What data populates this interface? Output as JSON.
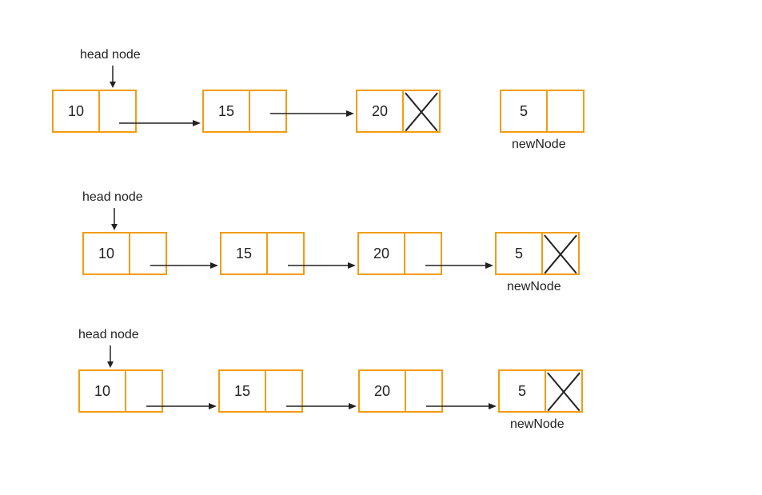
{
  "row1": {
    "headLabel": "head node",
    "nodes": [
      {
        "value": "10",
        "hasNext": true,
        "nullNext": false
      },
      {
        "value": "15",
        "hasNext": true,
        "nullNext": false
      },
      {
        "value": "20",
        "hasNext": false,
        "nullNext": true
      }
    ],
    "newNode": {
      "value": "5",
      "label": "newNode",
      "nullNext": false
    }
  },
  "row2": {
    "headLabel": "head node",
    "nodes": [
      {
        "value": "10",
        "hasNext": true,
        "nullNext": false
      },
      {
        "value": "15",
        "hasNext": true,
        "nullNext": false
      },
      {
        "value": "20",
        "hasNext": true,
        "nullNext": false
      },
      {
        "value": "5",
        "hasNext": false,
        "nullNext": true
      }
    ],
    "newNodeLabel": "newNode"
  },
  "row3": {
    "headLabel": "head node",
    "nodes": [
      {
        "value": "10",
        "hasNext": true,
        "nullNext": false
      },
      {
        "value": "15",
        "hasNext": true,
        "nullNext": false
      },
      {
        "value": "20",
        "hasNext": true,
        "nullNext": false
      },
      {
        "value": "5",
        "hasNext": false,
        "nullNext": true
      }
    ],
    "newNodeLabel": "newNode"
  }
}
